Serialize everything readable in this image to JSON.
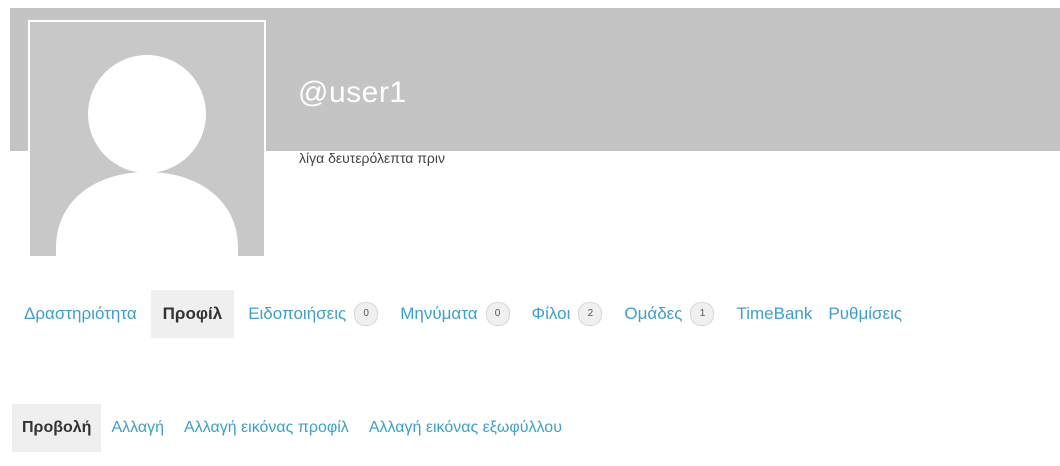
{
  "profile": {
    "username": "@user1",
    "last_active": "λίγα δευτερόλεπτα πριν"
  },
  "nav": {
    "items": [
      {
        "label": "Δραστηριότητα"
      },
      {
        "label": "Προφίλ",
        "active": true
      },
      {
        "label": "Ειδοποιήσεις",
        "count": "0"
      },
      {
        "label": "Μηνύματα",
        "count": "0"
      },
      {
        "label": "Φίλοι",
        "count": "2"
      },
      {
        "label": "Ομάδες",
        "count": "1"
      },
      {
        "label": "TimeBank"
      },
      {
        "label": "Ρυθμίσεις"
      }
    ]
  },
  "subnav": {
    "items": [
      {
        "label": "Προβολή",
        "active": true
      },
      {
        "label": "Αλλαγή"
      },
      {
        "label": "Αλλαγή εικόνας προφίλ"
      },
      {
        "label": "Αλλαγή εικόνας εξωφύλλου"
      }
    ]
  },
  "colors": {
    "cover": "#c4c4c4",
    "link": "#3d9fcb",
    "active_bg": "#efefef"
  },
  "icons": {
    "avatar": "default-avatar-silhouette"
  }
}
